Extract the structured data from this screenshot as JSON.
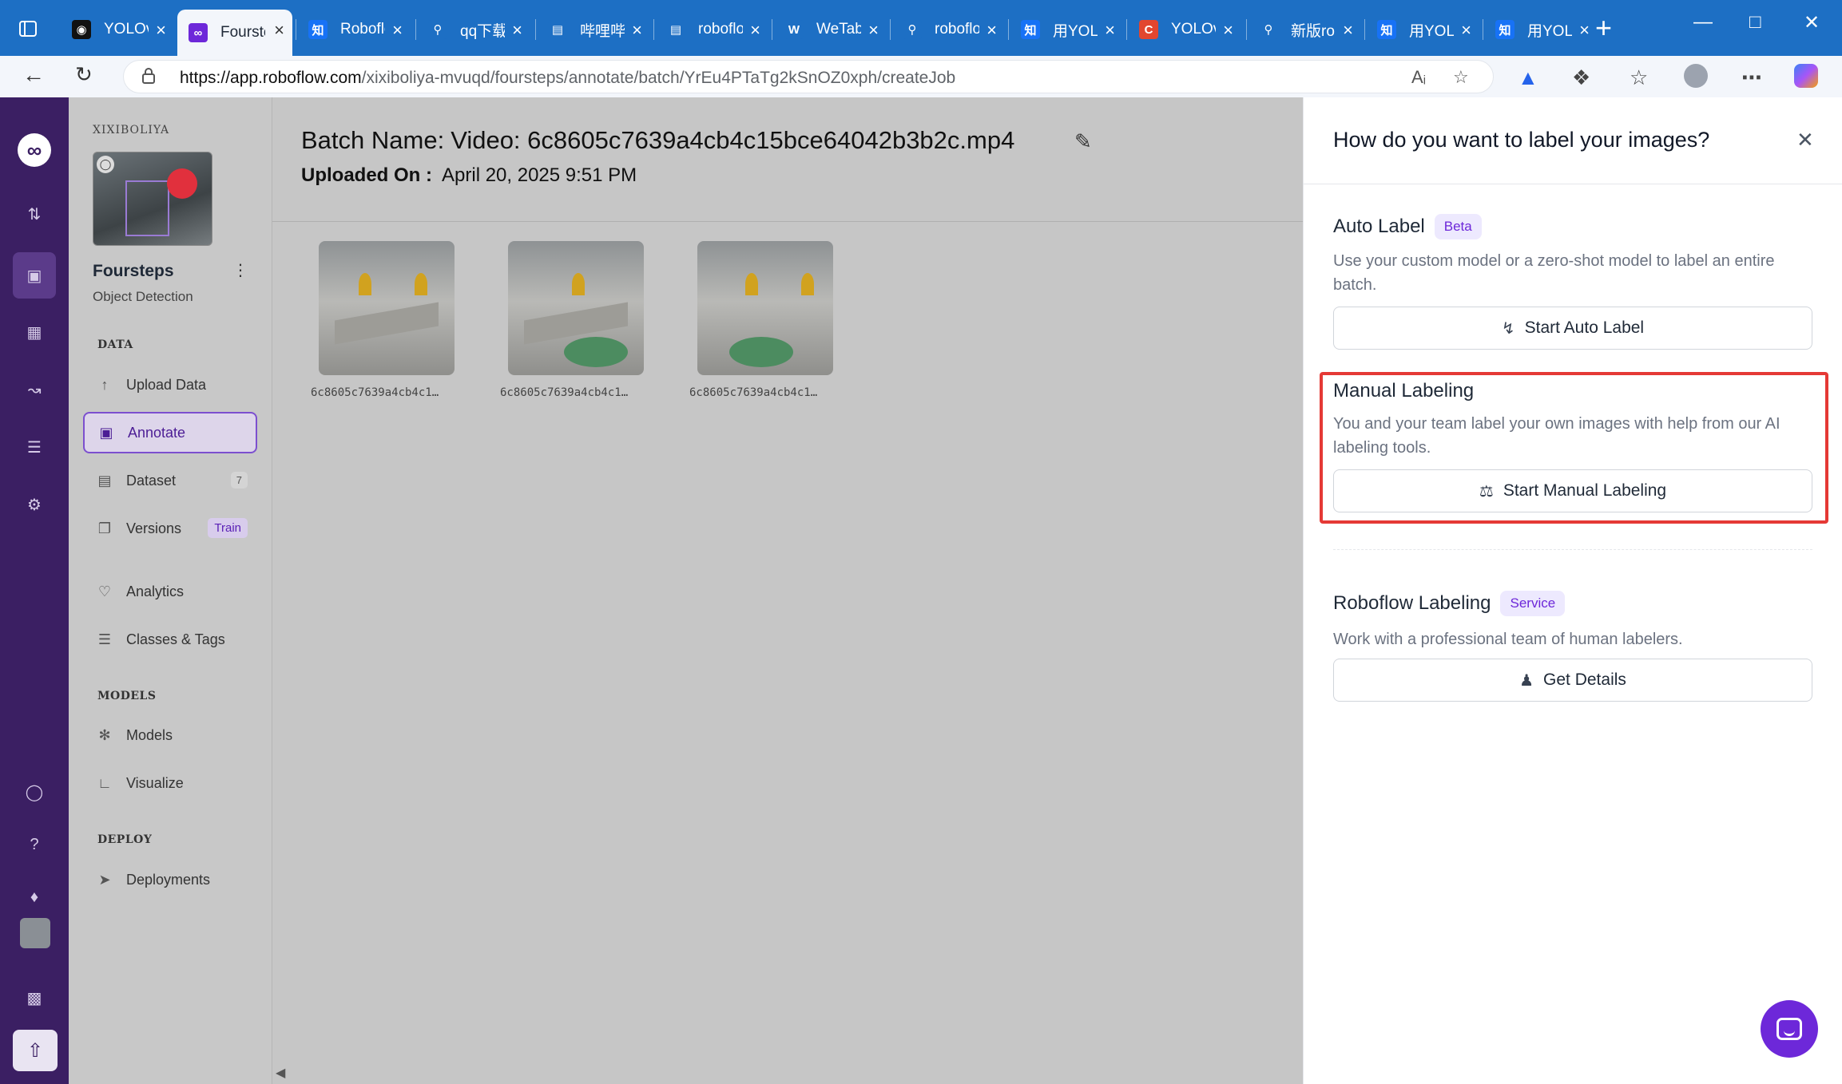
{
  "browser": {
    "tabs": [
      {
        "title": "YOLOv",
        "favicon": "github-icon",
        "color": "#111111"
      },
      {
        "title": "Foursteps",
        "favicon": "roboflow-icon",
        "color": "#6d28d9",
        "active": true
      },
      {
        "title": "Roboflow",
        "favicon": "zhihu-icon",
        "color": "#1772f6"
      },
      {
        "title": "qq下载",
        "favicon": "search-icon",
        "color": "#1d6fc4"
      },
      {
        "title": "哔哩哔哩",
        "favicon": "bilibili-icon",
        "color": "#1d6fc4"
      },
      {
        "title": "roboflow",
        "favicon": "bilibili-icon",
        "color": "#1d6fc4"
      },
      {
        "title": "WeTab",
        "favicon": "wetab-icon",
        "color": "#1d6fc4"
      },
      {
        "title": "roboflow",
        "favicon": "search-icon",
        "color": "#1d6fc4"
      },
      {
        "title": "用YOLO",
        "favicon": "zhihu-icon",
        "color": "#1772f6"
      },
      {
        "title": "YOLOv",
        "favicon": "csdn-icon",
        "color": "#e2462f"
      },
      {
        "title": "新版ro",
        "favicon": "search-icon",
        "color": "#1d6fc4"
      },
      {
        "title": "用YOLO",
        "favicon": "zhihu-icon",
        "color": "#1772f6"
      },
      {
        "title": "用YOLO",
        "favicon": "zhihu-icon",
        "color": "#1772f6"
      }
    ],
    "url_host": "https://app.roboflow.com",
    "url_path": "/xixiboliya-mvuqd/foursteps/annotate/batch/YrEu4PTaTg2kSnOZ0xph/createJob"
  },
  "sidebar": {
    "workspace": "XIXIBOLIYA",
    "project_name": "Foursteps",
    "project_type": "Object Detection",
    "sections": {
      "data": "DATA",
      "models": "MODELS",
      "deploy": "DEPLOY"
    },
    "items": {
      "upload": "Upload Data",
      "annotate": "Annotate",
      "dataset": "Dataset",
      "dataset_count": "7",
      "versions": "Versions",
      "versions_badge": "Train",
      "analytics": "Analytics",
      "classes": "Classes & Tags",
      "models": "Models",
      "visualize": "Visualize",
      "deployments": "Deployments"
    }
  },
  "main": {
    "batch_label": "Batch Name:",
    "batch_name": "Video: 6c8605c7639a4cb4c15bce64042b3b2c.mp4",
    "uploaded_label": "Uploaded On :",
    "uploaded_value": "April 20, 2025 9:51 PM",
    "images": [
      {
        "caption": "6c8605c7639a4cb4c1…"
      },
      {
        "caption": "6c8605c7639a4cb4c1…"
      },
      {
        "caption": "6c8605c7639a4cb4c1…"
      }
    ]
  },
  "panel": {
    "title": "How do you want to label your images?",
    "auto": {
      "title": "Auto Label",
      "badge": "Beta",
      "desc": "Use your custom model or a zero-shot model to label an entire batch.",
      "button": "Start Auto Label"
    },
    "manual": {
      "title": "Manual Labeling",
      "desc": "You and your team label your own images with help from our AI labeling tools.",
      "button": "Start Manual Labeling"
    },
    "roboflow": {
      "title": "Roboflow Labeling",
      "badge": "Service",
      "desc": "Work with a professional team of human labelers.",
      "button": "Get Details"
    }
  },
  "colors": {
    "accent": "#6d28d9",
    "highlight": "#e53935",
    "browser_blue": "#1d6fc4"
  }
}
